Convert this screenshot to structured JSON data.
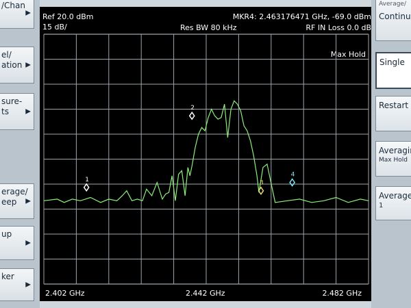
{
  "left_menu": [
    {
      "label": "/Chan",
      "arrow": "▶"
    },
    {
      "label": "el/\nation",
      "arrow": "▶"
    },
    {
      "label": "sure-\nts",
      "arrow": "▶"
    },
    {
      "label": "erage/\neep",
      "arrow": "▶"
    },
    {
      "label": "up",
      "arrow": "▶"
    },
    {
      "label": "ker",
      "arrow": "▶"
    }
  ],
  "right_menu": {
    "panel_title": "Average/",
    "continuous": "Continu",
    "single": "Single",
    "restart": "Restart",
    "averaging": "Averagin",
    "averaging_sub": "Max Hold",
    "average": "Average",
    "average_value": "1"
  },
  "header": {
    "ref": "Ref 20.0 dBm",
    "scale": "15 dB/",
    "res_bw": "Res BW 80 kHz",
    "marker": "MKR4: 2.463176471 GHz, -69.0 dBm",
    "rf_loss": "RF IN Loss 0.0 dB",
    "trace_mode": "Max Hold"
  },
  "footer": {
    "start": "2.402 GHz",
    "center": "2.442 GHz",
    "stop": "2.482 GHz"
  },
  "colors": {
    "trace": "#8df07a",
    "grid": "#9ea6ad",
    "marker_white": "#ffffff",
    "marker_yellow": "#e8d96a",
    "marker_cyan": "#7fe0ee"
  },
  "chart_data": {
    "type": "line",
    "x_unit": "GHz",
    "y_unit": "dBm",
    "xlim": [
      2.402,
      2.482
    ],
    "ylim": [
      -130,
      20
    ],
    "grid": true,
    "trace": {
      "x": [
        2.402,
        2.4053,
        2.407,
        2.409,
        2.411,
        2.4135,
        2.416,
        2.418,
        2.42,
        2.4213,
        2.4224,
        2.4237,
        2.425,
        2.4263,
        2.4273,
        2.4286,
        2.4299,
        2.4312,
        2.432,
        2.4328,
        2.4336,
        2.4344,
        2.4352,
        2.436,
        2.4368,
        2.4375,
        2.438,
        2.4385,
        2.4393,
        2.4401,
        2.4409,
        2.4417,
        2.4425,
        2.4433,
        2.4441,
        2.4449,
        2.4457,
        2.4465,
        2.4473,
        2.4481,
        2.4489,
        2.4497,
        2.4505,
        2.4513,
        2.4521,
        2.4529,
        2.4537,
        2.4545,
        2.455,
        2.456,
        2.457,
        2.459,
        2.462,
        2.465,
        2.468,
        2.471,
        2.474,
        2.477,
        2.48,
        2.482
      ],
      "y": [
        -80,
        -79,
        -81,
        -79,
        -80,
        -78,
        -81,
        -79,
        -80,
        -77,
        -74,
        -80,
        -79,
        -80,
        -73,
        -77,
        -69,
        -79,
        -76,
        -75,
        -65,
        -80,
        -64,
        -62,
        -77,
        -60,
        -65,
        -59,
        -48,
        -40,
        -36,
        -38,
        -30,
        -25,
        -29,
        -31,
        -30,
        -22,
        -42,
        -25,
        -20,
        -22,
        -26,
        -35,
        -38,
        -44,
        -53,
        -65,
        -75,
        -60,
        -58,
        -81,
        -80,
        -79,
        -81,
        -80,
        -78,
        -81,
        -79,
        -80
      ]
    },
    "markers": [
      {
        "label": "1",
        "x": 2.4125,
        "y": -72
      },
      {
        "label": "2",
        "x": 2.4385,
        "y": -29
      },
      {
        "label": "3",
        "x": 2.4555,
        "y": -74
      },
      {
        "label": "4",
        "x": 2.4632,
        "y": -69
      }
    ]
  }
}
